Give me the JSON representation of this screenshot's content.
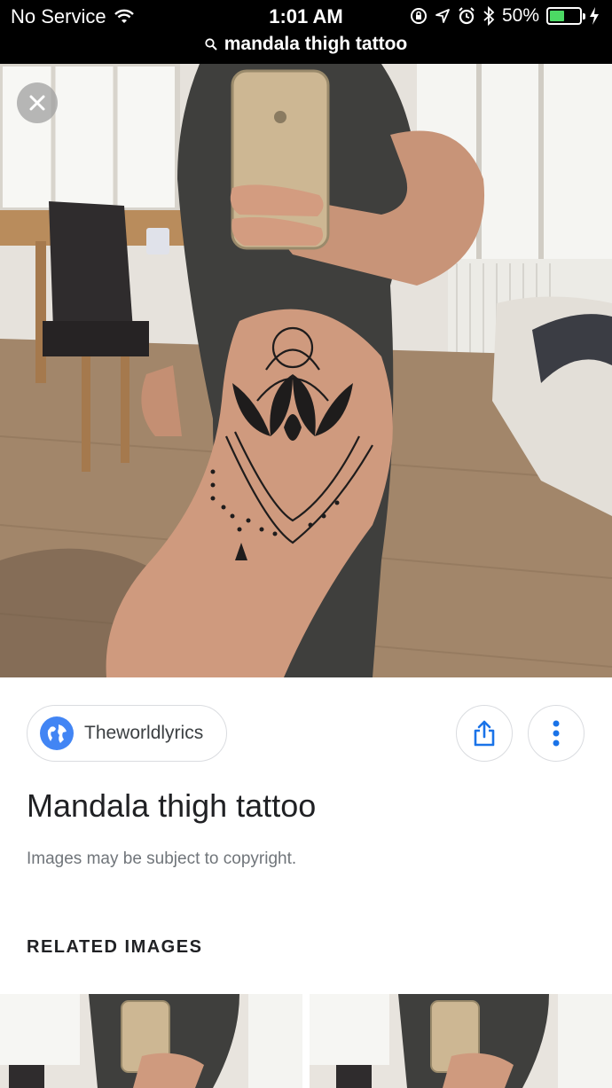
{
  "status_bar": {
    "carrier": "No Service",
    "time": "1:01 AM",
    "battery": "50%",
    "battery_level": 0.5,
    "icons": [
      "wifi-icon",
      "lock-rotation-icon",
      "location-icon",
      "alarm-icon",
      "bluetooth-icon",
      "battery-icon",
      "charging-icon"
    ]
  },
  "search": {
    "query": "mandala thigh tattoo",
    "icon": "search-icon"
  },
  "viewer": {
    "close_icon": "close-icon",
    "source_name": "Theworldlyrics",
    "source_icon": "globe-icon",
    "share_icon": "share-icon",
    "more_icon": "more-vert-icon",
    "title": "Mandala thigh tattoo",
    "notice": "Images may be subject to copyright."
  },
  "related": {
    "heading": "RELATED IMAGES"
  },
  "colors": {
    "accent_blue": "#4285f4",
    "battery_green": "#4cd964",
    "border": "#dadce0"
  }
}
